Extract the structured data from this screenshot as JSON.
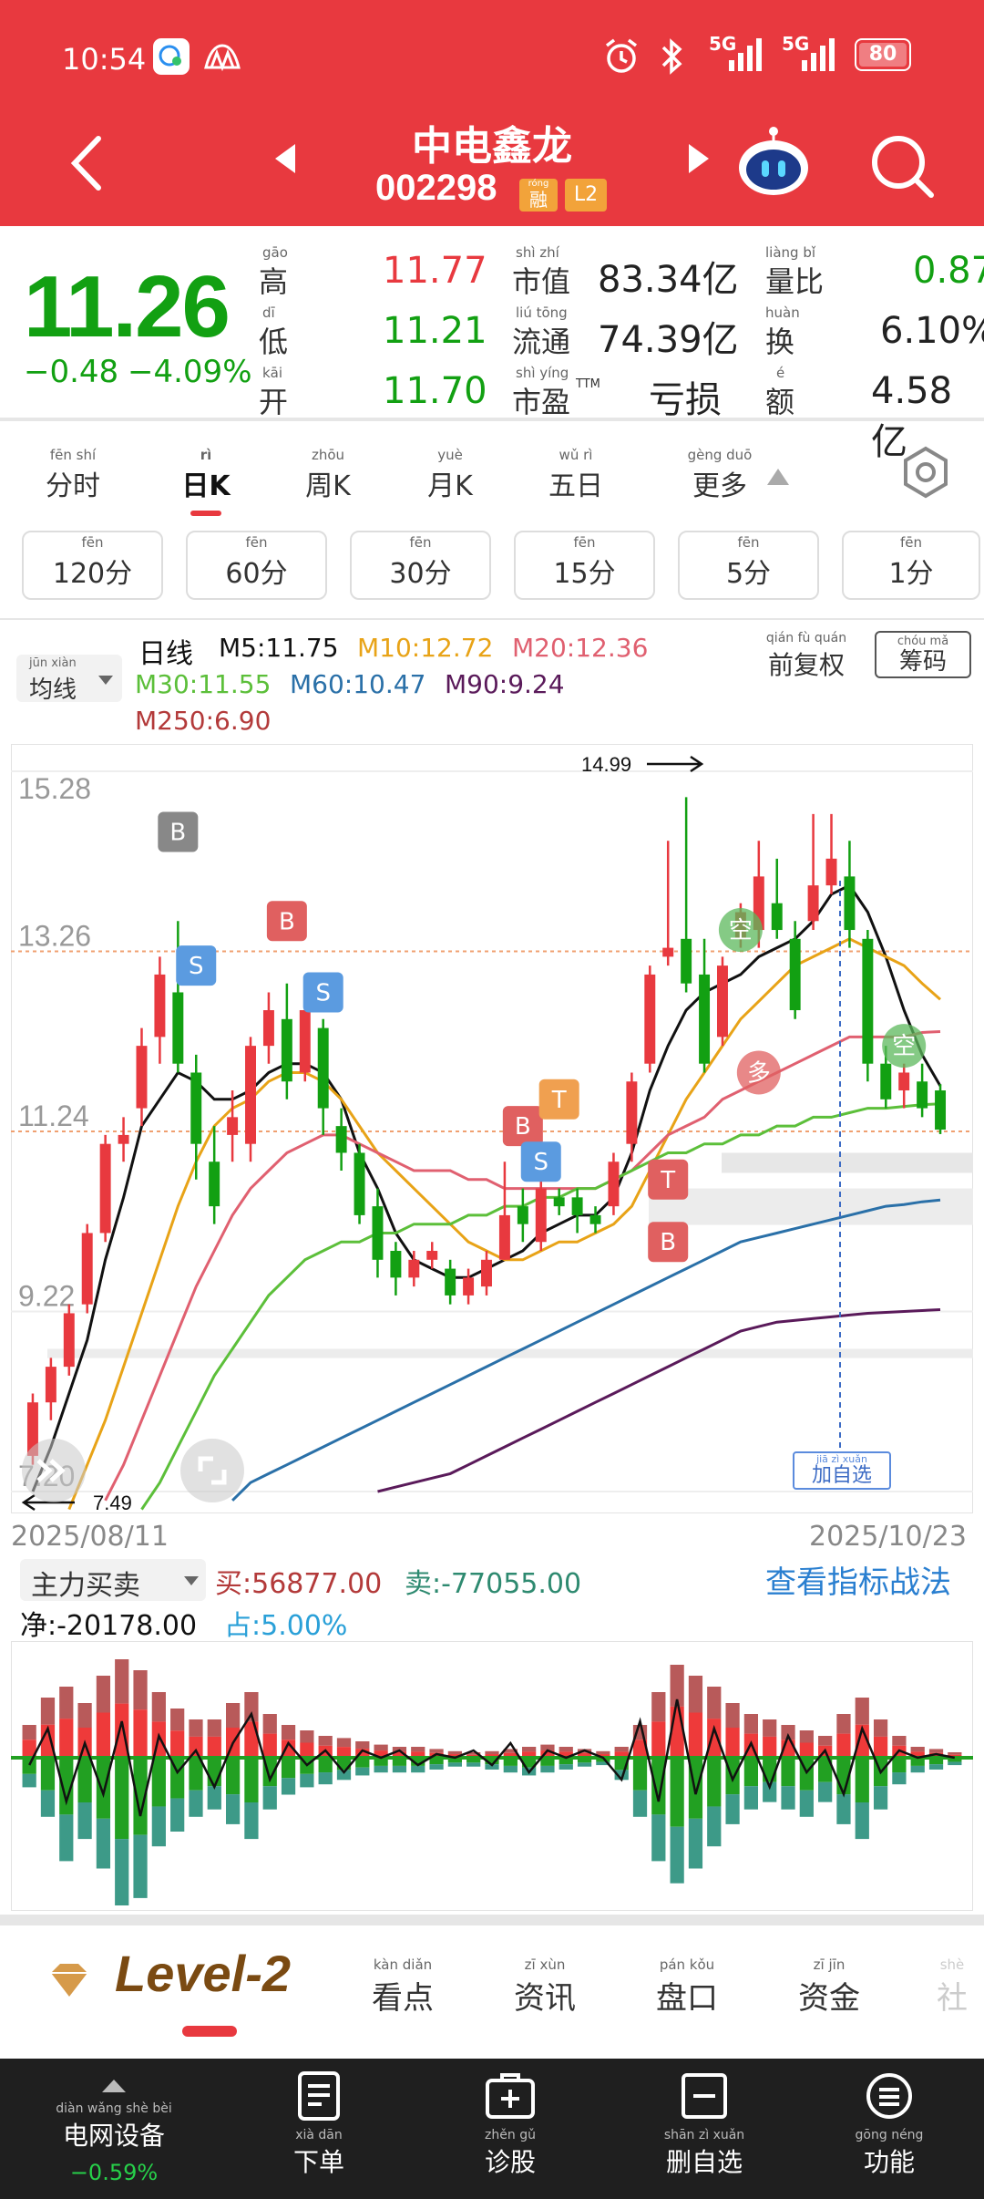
{
  "status_bar": {
    "time": "10:54",
    "network_1": "5G",
    "network_2": "5G",
    "battery": "80"
  },
  "header": {
    "stock_name": "中电鑫龙",
    "stock_code": "002298",
    "badge_rong_pinyin": "róng",
    "badge_rong": "融",
    "badge_l2": "L2"
  },
  "quote": {
    "price": "11.26",
    "change": "−0.48",
    "change_pct": "−4.09%",
    "high_pinyin": "gāo",
    "high_label": "高",
    "high_value": "11.77",
    "low_pinyin": "dī",
    "low_label": "低",
    "low_value": "11.21",
    "open_pinyin": "kāi",
    "open_label": "开",
    "open_value": "11.70",
    "mcap_pinyin": "shì zhí",
    "mcap_label": "市值",
    "mcap_value": "83.34亿",
    "float_pinyin": "liú tōng",
    "float_label": "流通",
    "float_value": "74.39亿",
    "pe_pinyin": "shì yíng",
    "pe_label": "市盈",
    "pe_sup": "TTM",
    "pe_value": "亏损",
    "vol_ratio_pinyin": "liàng bǐ",
    "vol_ratio_label": "量比",
    "vol_ratio_value": "0.87",
    "turnover_pinyin": "huàn",
    "turnover_label": "换",
    "turnover_value": "6.10%",
    "amount_pinyin": "é",
    "amount_label": "额",
    "amount_value": "4.58亿"
  },
  "period_tabs": [
    {
      "pinyin": "fēn shí",
      "label": "分时"
    },
    {
      "pinyin": "rì",
      "label": "日K"
    },
    {
      "pinyin": "zhōu",
      "label": "周K"
    },
    {
      "pinyin": "yuè",
      "label": "月K"
    },
    {
      "pinyin": "wǔ rì",
      "label": "五日"
    },
    {
      "pinyin": "gèng duō",
      "label": "更多"
    }
  ],
  "minute_buttons": [
    {
      "pinyin": "fēn",
      "label": "120分"
    },
    {
      "pinyin": "fēn",
      "label": "60分"
    },
    {
      "pinyin": "fēn",
      "label": "30分"
    },
    {
      "pinyin": "fēn",
      "label": "15分"
    },
    {
      "pinyin": "fēn",
      "label": "5分"
    },
    {
      "pinyin": "fēn",
      "label": "1分"
    }
  ],
  "indicator": {
    "ma_select_pinyin": "jūn xiàn",
    "ma_select": "均线",
    "line_type": "日线",
    "m5": "M5:11.75",
    "m10": "M10:12.72",
    "m20": "M20:12.36",
    "m30": "M30:11.55",
    "m60": "M60:10.47",
    "m90": "M90:9.24",
    "m250": "M250:6.90",
    "adjust_pinyin": "qián fù quán",
    "adjust": "前复权",
    "chip_pinyin": "chóu mǎ",
    "chip": "筹码"
  },
  "chart_data": {
    "type": "candlestick",
    "date_start": "2025/08/11",
    "date_end": "2025/10/23",
    "y_ticks": [
      "15.28",
      "13.26",
      "11.24",
      "9.22",
      "7.20"
    ],
    "ylim": [
      7.2,
      15.28
    ],
    "max_label": "14.99",
    "min_label": "7.49",
    "markers": [
      "B",
      "S",
      "B",
      "S",
      "B",
      "S",
      "T",
      "B",
      "T",
      "空",
      "空",
      "多"
    ],
    "candles": [
      {
        "o": 7.6,
        "c": 8.2,
        "h": 8.3,
        "l": 7.5
      },
      {
        "o": 8.2,
        "c": 8.6,
        "h": 8.7,
        "l": 8.0
      },
      {
        "o": 8.6,
        "c": 9.2,
        "h": 9.3,
        "l": 8.5
      },
      {
        "o": 9.3,
        "c": 10.1,
        "h": 10.2,
        "l": 9.2
      },
      {
        "o": 10.1,
        "c": 11.1,
        "h": 11.2,
        "l": 10.0
      },
      {
        "o": 11.1,
        "c": 11.2,
        "h": 11.4,
        "l": 10.9
      },
      {
        "o": 11.5,
        "c": 12.2,
        "h": 12.4,
        "l": 11.3
      },
      {
        "o": 12.3,
        "c": 13.0,
        "h": 13.2,
        "l": 12.0
      },
      {
        "o": 12.8,
        "c": 12.0,
        "h": 13.6,
        "l": 11.9
      },
      {
        "o": 11.9,
        "c": 11.1,
        "h": 12.1,
        "l": 10.7
      },
      {
        "o": 10.9,
        "c": 10.4,
        "h": 11.3,
        "l": 10.2
      },
      {
        "o": 11.2,
        "c": 11.4,
        "h": 11.7,
        "l": 10.9
      },
      {
        "o": 11.1,
        "c": 12.2,
        "h": 12.3,
        "l": 10.9
      },
      {
        "o": 12.2,
        "c": 12.6,
        "h": 12.8,
        "l": 12.0
      },
      {
        "o": 12.5,
        "c": 11.8,
        "h": 12.9,
        "l": 11.6
      },
      {
        "o": 11.9,
        "c": 12.6,
        "h": 12.8,
        "l": 11.8
      },
      {
        "o": 12.4,
        "c": 11.5,
        "h": 12.5,
        "l": 11.2
      },
      {
        "o": 11.3,
        "c": 11.0,
        "h": 11.5,
        "l": 10.8
      },
      {
        "o": 11.0,
        "c": 10.3,
        "h": 11.1,
        "l": 10.2
      },
      {
        "o": 10.4,
        "c": 9.8,
        "h": 10.6,
        "l": 9.6
      },
      {
        "o": 9.9,
        "c": 9.6,
        "h": 10.0,
        "l": 9.4
      },
      {
        "o": 9.6,
        "c": 9.8,
        "h": 9.9,
        "l": 9.5
      },
      {
        "o": 9.8,
        "c": 9.9,
        "h": 10.0,
        "l": 9.7
      },
      {
        "o": 9.7,
        "c": 9.4,
        "h": 9.8,
        "l": 9.3
      },
      {
        "o": 9.4,
        "c": 9.6,
        "h": 9.7,
        "l": 9.3
      },
      {
        "o": 9.5,
        "c": 9.8,
        "h": 9.9,
        "l": 9.4
      },
      {
        "o": 9.8,
        "c": 10.3,
        "h": 10.9,
        "l": 9.8
      },
      {
        "o": 10.4,
        "c": 10.2,
        "h": 10.6,
        "l": 10.0
      },
      {
        "o": 10.0,
        "c": 10.6,
        "h": 11.0,
        "l": 9.9
      },
      {
        "o": 10.5,
        "c": 10.4,
        "h": 10.6,
        "l": 10.3
      },
      {
        "o": 10.5,
        "c": 10.3,
        "h": 10.6,
        "l": 10.1
      },
      {
        "o": 10.3,
        "c": 10.2,
        "h": 10.4,
        "l": 10.1
      },
      {
        "o": 10.4,
        "c": 10.9,
        "h": 11.0,
        "l": 10.3
      },
      {
        "o": 11.1,
        "c": 11.8,
        "h": 11.9,
        "l": 10.9
      },
      {
        "o": 12.0,
        "c": 13.0,
        "h": 13.1,
        "l": 11.9
      },
      {
        "o": 13.2,
        "c": 13.3,
        "h": 14.5,
        "l": 13.1
      },
      {
        "o": 13.4,
        "c": 12.9,
        "h": 14.99,
        "l": 12.8
      },
      {
        "o": 13.0,
        "c": 12.0,
        "h": 13.4,
        "l": 11.9
      },
      {
        "o": 12.3,
        "c": 13.1,
        "h": 13.2,
        "l": 12.2
      },
      {
        "o": 13.4,
        "c": 13.7,
        "h": 13.8,
        "l": 13.3
      },
      {
        "o": 13.5,
        "c": 14.1,
        "h": 14.5,
        "l": 13.3
      },
      {
        "o": 13.8,
        "c": 13.5,
        "h": 14.3,
        "l": 13.4
      },
      {
        "o": 13.4,
        "c": 12.6,
        "h": 13.6,
        "l": 12.5
      },
      {
        "o": 13.6,
        "c": 14.0,
        "h": 14.8,
        "l": 13.5
      },
      {
        "o": 14.0,
        "c": 14.3,
        "h": 14.8,
        "l": 13.9
      },
      {
        "o": 14.1,
        "c": 13.5,
        "h": 14.5,
        "l": 13.3
      },
      {
        "o": 13.4,
        "c": 12.0,
        "h": 13.5,
        "l": 11.8
      },
      {
        "o": 12.0,
        "c": 11.6,
        "h": 12.2,
        "l": 11.5
      },
      {
        "o": 11.7,
        "c": 11.9,
        "h": 12.0,
        "l": 11.5
      },
      {
        "o": 11.8,
        "c": 11.5,
        "h": 12.0,
        "l": 11.4
      },
      {
        "o": 11.7,
        "c": 11.26,
        "h": 11.77,
        "l": 11.21
      }
    ],
    "series": [
      {
        "name": "M5",
        "color": "#111111",
        "values": [
          7.2,
          7.7,
          8.3,
          8.9,
          9.8,
          10.5,
          11.3,
          11.6,
          11.9,
          11.8,
          11.6,
          11.6,
          11.7,
          11.9,
          12.0,
          12.0,
          11.9,
          11.6,
          11.0,
          10.6,
          10.1,
          9.8,
          9.7,
          9.6,
          9.6,
          9.7,
          9.8,
          9.9,
          10.1,
          10.2,
          10.3,
          10.3,
          10.5,
          11.0,
          11.7,
          12.2,
          12.6,
          12.8,
          12.9,
          13.0,
          13.2,
          13.3,
          13.4,
          13.6,
          13.9,
          14.0,
          13.7,
          13.2,
          12.6,
          12.1,
          11.75
        ]
      },
      {
        "name": "M10",
        "color": "#e8a317",
        "values": [
          null,
          null,
          7.0,
          7.5,
          8.0,
          8.6,
          9.2,
          9.8,
          10.4,
          10.9,
          11.3,
          11.5,
          11.6,
          11.8,
          11.9,
          11.9,
          11.8,
          11.6,
          11.3,
          11.0,
          10.8,
          10.6,
          10.4,
          10.2,
          10.0,
          9.9,
          9.8,
          9.8,
          9.9,
          10.0,
          10.0,
          10.1,
          10.2,
          10.4,
          10.8,
          11.2,
          11.6,
          11.9,
          12.2,
          12.5,
          12.7,
          12.9,
          13.1,
          13.2,
          13.3,
          13.4,
          13.3,
          13.2,
          13.1,
          12.9,
          12.72
        ]
      },
      {
        "name": "M20",
        "color": "#e06070",
        "values": [
          null,
          null,
          null,
          null,
          7.1,
          7.5,
          8.0,
          8.5,
          9.0,
          9.5,
          9.9,
          10.3,
          10.6,
          10.8,
          11.0,
          11.1,
          11.2,
          11.2,
          11.1,
          11.0,
          10.9,
          10.8,
          10.8,
          10.8,
          10.7,
          10.7,
          10.6,
          10.6,
          10.6,
          10.6,
          10.6,
          10.6,
          10.7,
          10.8,
          11.0,
          11.2,
          11.3,
          11.4,
          11.6,
          11.7,
          11.8,
          11.9,
          12.0,
          12.1,
          12.2,
          12.3,
          12.3,
          12.3,
          12.3,
          12.35,
          12.36
        ]
      },
      {
        "name": "M30",
        "color": "#5cbf3a",
        "values": [
          null,
          null,
          null,
          null,
          null,
          null,
          7.0,
          7.3,
          7.7,
          8.1,
          8.5,
          8.8,
          9.1,
          9.4,
          9.6,
          9.8,
          9.9,
          10.0,
          10.0,
          10.1,
          10.1,
          10.2,
          10.2,
          10.2,
          10.3,
          10.3,
          10.4,
          10.4,
          10.5,
          10.5,
          10.6,
          10.6,
          10.7,
          10.8,
          10.9,
          11.0,
          11.0,
          11.1,
          11.1,
          11.2,
          11.2,
          11.3,
          11.3,
          11.4,
          11.4,
          11.45,
          11.5,
          11.5,
          11.52,
          11.54,
          11.55
        ]
      },
      {
        "name": "M60",
        "color": "#2a70a8",
        "values": [
          null,
          null,
          null,
          null,
          null,
          null,
          null,
          null,
          null,
          null,
          null,
          7.1,
          7.3,
          7.4,
          7.5,
          7.6,
          7.7,
          7.8,
          7.9,
          8.0,
          8.1,
          8.2,
          8.3,
          8.4,
          8.5,
          8.6,
          8.7,
          8.8,
          8.9,
          9.0,
          9.1,
          9.2,
          9.3,
          9.4,
          9.5,
          9.6,
          9.7,
          9.8,
          9.9,
          10.0,
          10.05,
          10.1,
          10.15,
          10.2,
          10.25,
          10.3,
          10.35,
          10.4,
          10.42,
          10.45,
          10.47
        ]
      },
      {
        "name": "M90",
        "color": "#5a1a5a",
        "values": [
          null,
          null,
          null,
          null,
          null,
          null,
          null,
          null,
          null,
          null,
          null,
          null,
          null,
          null,
          null,
          null,
          null,
          null,
          null,
          7.2,
          7.25,
          7.3,
          7.35,
          7.4,
          7.5,
          7.6,
          7.7,
          7.8,
          7.9,
          8.0,
          8.1,
          8.2,
          8.3,
          8.4,
          8.5,
          8.6,
          8.7,
          8.8,
          8.9,
          9.0,
          9.05,
          9.1,
          9.12,
          9.14,
          9.16,
          9.18,
          9.2,
          9.21,
          9.22,
          9.23,
          9.24
        ]
      }
    ]
  },
  "chart_controls": {
    "add_watch_pinyin": "jiā zì xuǎn",
    "add_watch": "加自选"
  },
  "capital_flow": {
    "select": "主力买卖",
    "buy": "买:56877.00",
    "sell": "卖:-77055.00",
    "net": "净:-20178.00",
    "ratio": "占:5.00%",
    "link": "查看指标战法",
    "buy_bars": [
      0.3,
      0.55,
      0.65,
      0.5,
      0.75,
      0.9,
      0.8,
      0.6,
      0.45,
      0.35,
      0.35,
      0.5,
      0.6,
      0.4,
      0.3,
      0.25,
      0.2,
      0.18,
      0.15,
      0.12,
      0.1,
      0.1,
      0.08,
      0.06,
      0.05,
      0.06,
      0.08,
      0.1,
      0.12,
      0.1,
      0.08,
      0.06,
      0.1,
      0.3,
      0.6,
      0.85,
      0.75,
      0.65,
      0.5,
      0.4,
      0.35,
      0.3,
      0.25,
      0.2,
      0.4,
      0.55,
      0.35,
      0.2,
      0.1,
      0.08,
      0.05
    ],
    "sell_bars": [
      0.2,
      0.4,
      0.7,
      0.55,
      0.75,
      1.0,
      0.95,
      0.6,
      0.5,
      0.4,
      0.35,
      0.45,
      0.55,
      0.35,
      0.25,
      0.2,
      0.18,
      0.15,
      0.12,
      0.1,
      0.1,
      0.1,
      0.08,
      0.06,
      0.06,
      0.08,
      0.1,
      0.12,
      0.1,
      0.08,
      0.06,
      0.05,
      0.15,
      0.4,
      0.7,
      0.85,
      0.75,
      0.6,
      0.45,
      0.35,
      0.3,
      0.35,
      0.4,
      0.3,
      0.45,
      0.55,
      0.35,
      0.18,
      0.1,
      0.08,
      0.05
    ],
    "net_line": [
      -0.1,
      0.4,
      -0.6,
      0.2,
      -0.5,
      0.5,
      -0.8,
      0.3,
      -0.2,
      0.1,
      -0.4,
      0.2,
      0.6,
      -0.3,
      0.2,
      -0.1,
      0.1,
      -0.2,
      0.1,
      0.0,
      0.1,
      -0.1,
      0.05,
      0.0,
      0.1,
      -0.1,
      0.2,
      -0.2,
      0.1,
      0.0,
      0.1,
      0.0,
      -0.3,
      0.5,
      -0.6,
      0.8,
      -0.5,
      0.4,
      -0.3,
      0.2,
      -0.4,
      0.3,
      -0.2,
      0.1,
      -0.5,
      0.4,
      -0.2,
      0.1,
      0.0,
      0.05,
      0.0
    ]
  },
  "news_tabs": {
    "level2": "Level-2",
    "items": [
      {
        "pinyin": "kàn diǎn",
        "label": "看点"
      },
      {
        "pinyin": "zī xùn",
        "label": "资讯"
      },
      {
        "pinyin": "pán kǒu",
        "label": "盘口"
      },
      {
        "pinyin": "zī jīn",
        "label": "资金"
      },
      {
        "pinyin": "shè",
        "label": "社"
      }
    ]
  },
  "bottom_bar": {
    "items": [
      {
        "pinyin": "diàn wǎng shè bèi",
        "label": "电网设备",
        "sub": "−0.59%"
      },
      {
        "pinyin": "xià dān",
        "label": "下单"
      },
      {
        "pinyin": "zhěn gǔ",
        "label": "诊股"
      },
      {
        "pinyin": "shān zì xuǎn",
        "label": "删自选"
      },
      {
        "pinyin": "gōng néng",
        "label": "功能"
      }
    ]
  },
  "colors": {
    "brand_red": "#e8393f",
    "up": "#e8393f",
    "down": "#12a012",
    "dark_bar": "#1f1f1f"
  }
}
